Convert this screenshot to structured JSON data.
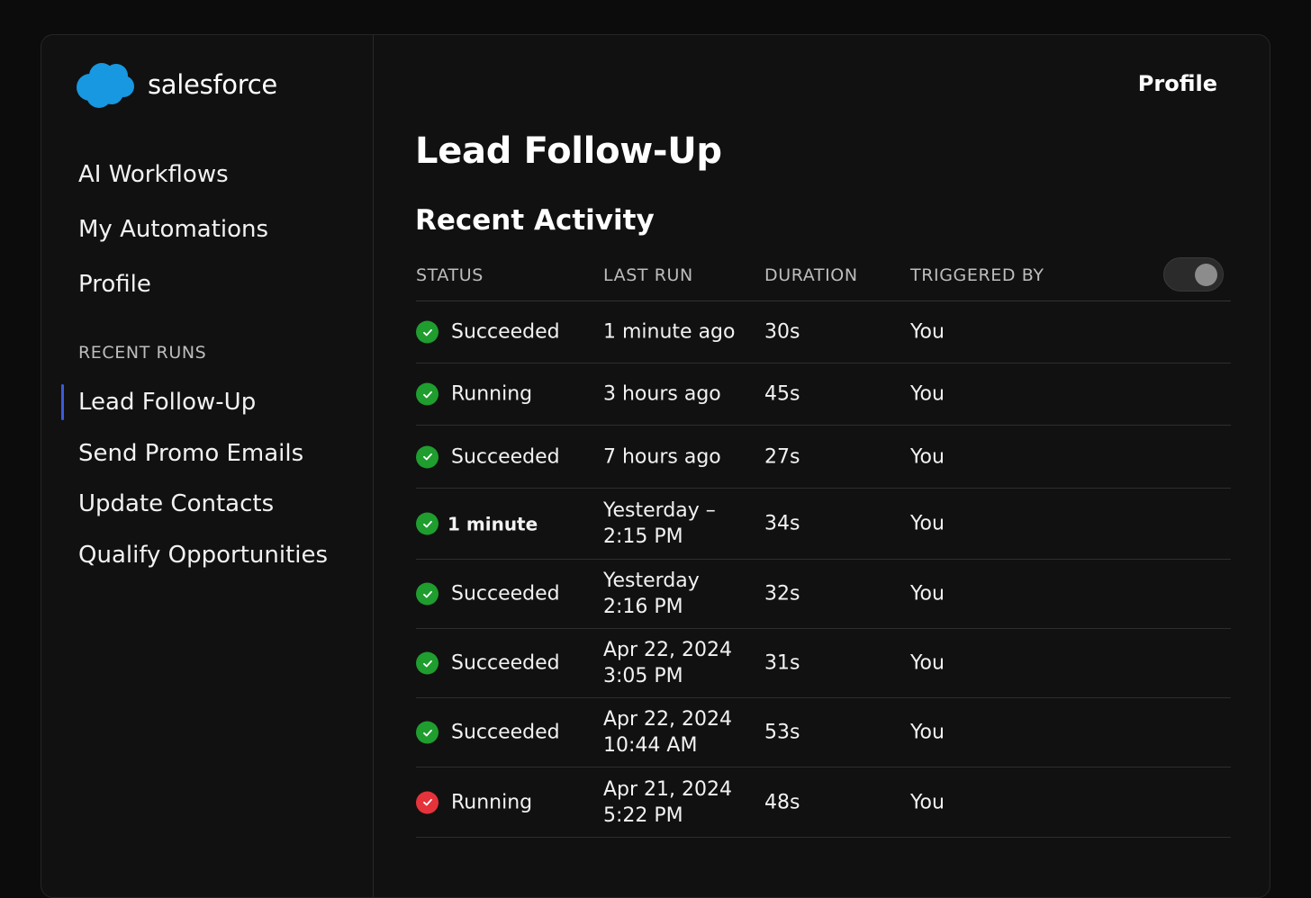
{
  "brand": {
    "name": "salesforce",
    "color": "#1798e0"
  },
  "sidebar": {
    "nav": [
      {
        "label": "AI Workflows"
      },
      {
        "label": "My Automations"
      },
      {
        "label": "Profile"
      }
    ],
    "recent_runs_label": "RECENT RUNS",
    "recent_runs": [
      {
        "label": "Lead Follow-Up",
        "active": true
      },
      {
        "label": "Send Promo Emails",
        "active": false
      },
      {
        "label": "Update Contacts",
        "active": false
      },
      {
        "label": "Qualify Opportunities",
        "active": false
      }
    ],
    "active_indicator_color": "#3b5bdb"
  },
  "header": {
    "profile_label": "Profile"
  },
  "main": {
    "title": "Lead Follow-Up",
    "section_title": "Recent Activity",
    "toggle": {
      "on": false
    },
    "table": {
      "columns": [
        "STATUS",
        "LAST RUN",
        "DURATION",
        "TRIGGERED BY"
      ],
      "rows": [
        {
          "status": "Succeeded",
          "status_icon": "check-circle-icon",
          "status_color": "#1f9d2e",
          "last_run": [
            "1 minute ago"
          ],
          "duration": "30s",
          "triggered_by": "You"
        },
        {
          "status": "Running",
          "status_icon": "check-circle-icon",
          "status_color": "#1f9d2e",
          "last_run": [
            "3 hours ago"
          ],
          "duration": "45s",
          "triggered_by": "You"
        },
        {
          "status": "Succeeded",
          "status_icon": "check-circle-icon",
          "status_color": "#1f9d2e",
          "last_run": [
            "7 hours ago"
          ],
          "duration": "27s",
          "triggered_by": "You"
        },
        {
          "status": "1 minute",
          "status_icon": "check-circle-icon",
          "status_color": "#1f9d2e",
          "last_run": [
            "Yesterday –",
            "2:15 PM"
          ],
          "duration": "34s",
          "triggered_by": "You"
        },
        {
          "status": "Succeeded",
          "status_icon": "check-circle-icon",
          "status_color": "#1f9d2e",
          "last_run": [
            "Yesterday",
            "2:16 PM"
          ],
          "duration": "32s",
          "triggered_by": "You"
        },
        {
          "status": "Succeeded",
          "status_icon": "check-circle-icon",
          "status_color": "#1f9d2e",
          "last_run": [
            "Apr 22, 2024",
            "3:05 PM"
          ],
          "duration": "31s",
          "triggered_by": "You"
        },
        {
          "status": "Succeeded",
          "status_icon": "check-circle-icon",
          "status_color": "#1f9d2e",
          "last_run": [
            "Apr 22, 2024",
            "10:44 AM"
          ],
          "duration": "53s",
          "triggered_by": "You"
        },
        {
          "status": "Running",
          "status_icon": "check-circle-icon",
          "status_color": "#e5333b",
          "last_run": [
            "Apr 21, 2024",
            "5:22 PM"
          ],
          "duration": "48s",
          "triggered_by": "You"
        }
      ]
    }
  }
}
